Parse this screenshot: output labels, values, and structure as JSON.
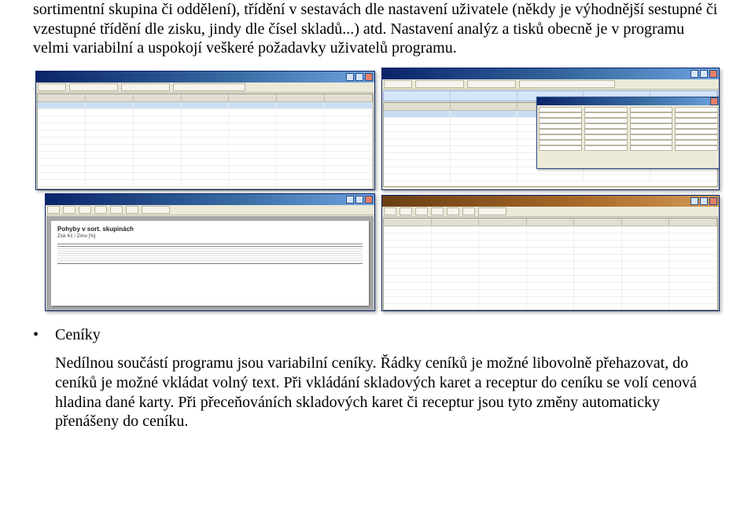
{
  "paragraphs": {
    "p1": "sortimentní skupina či oddělení), třídění v sestavách dle nastavení uživatele (někdy je výhodnější sestupné či vzestupné třídění dle zisku, jindy dle čísel skladů...) atd. Nastavení analýz a tisků obecně je v programu velmi variabilní a uspokojí veškeré požadavky uživatelů programu.",
    "bullet_label": "Ceníky",
    "p2": "Nedílnou součástí programu jsou variabilní ceníky. Řádky ceníků je možné libovolně přehazovat, do ceníků je možné vkládat volný text. Při vkládání skladových karet a receptur do ceníku se volí cenová hladina dané karty. Při přeceňováních skladových karet či receptur jsou tyto změny automaticky přenášeny do ceníku."
  },
  "preview": {
    "title": "Pohyby v sort. skupinách",
    "subtitle": "Zisk Kč / Zimo [%]"
  }
}
